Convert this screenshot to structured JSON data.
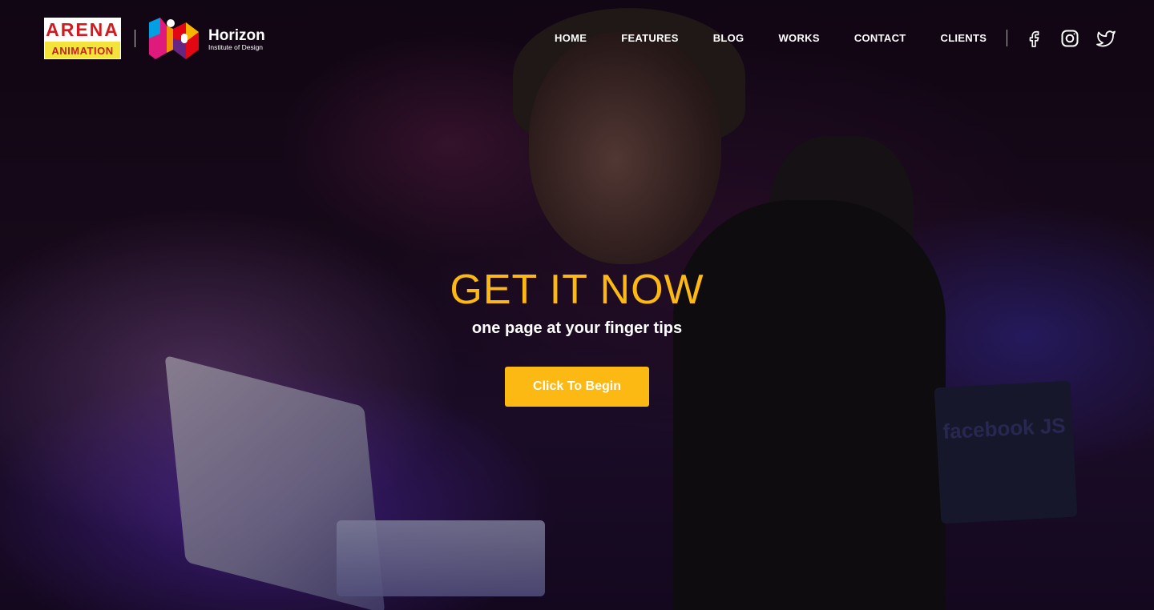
{
  "brand": {
    "arena_top": "ARENA",
    "arena_bottom": "ANIMATION",
    "horizon_title": "Horizon",
    "horizon_subtitle": "Institute of Design"
  },
  "nav": {
    "items": [
      {
        "label": "HOME"
      },
      {
        "label": "FEATURES"
      },
      {
        "label": "BLOG"
      },
      {
        "label": "WORKS"
      },
      {
        "label": "CONTACT"
      },
      {
        "label": "CLIENTS"
      }
    ]
  },
  "social": {
    "icons": [
      "facebook-icon",
      "instagram-icon",
      "twitter-icon"
    ]
  },
  "hero": {
    "title": "GET IT NOW",
    "subtitle": "one page at your finger tips",
    "cta_label": "Click To Begin",
    "background_text": "facebook JS"
  },
  "colors": {
    "accent": "#fdb913",
    "arena_red": "#d11b20",
    "arena_yellow": "#f4e33a",
    "text": "#ffffff"
  }
}
